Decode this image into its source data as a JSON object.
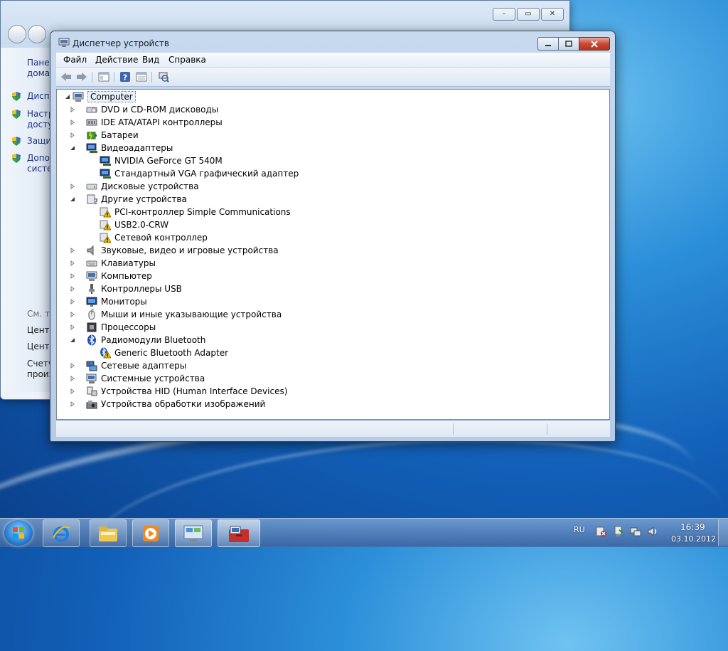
{
  "back_window": {
    "sidebar": [
      {
        "text": "Панел",
        "style": "link"
      },
      {
        "text": "домаш",
        "style": "link"
      },
      {
        "text": "Диспе",
        "style": "link",
        "shield": true
      },
      {
        "text": "Настр",
        "style": "link",
        "shield": true
      },
      {
        "text": "досту",
        "style": "link"
      },
      {
        "text": "Защит",
        "style": "link",
        "shield": true
      },
      {
        "text": "Допол",
        "style": "link",
        "shield": true
      },
      {
        "text": "систем",
        "style": "link"
      },
      {
        "text": "См. та",
        "style": "muted"
      },
      {
        "text": "Центр",
        "style": "dark"
      },
      {
        "text": "Центр",
        "style": "dark"
      },
      {
        "text": "Счетч",
        "style": "dark"
      },
      {
        "text": "произ",
        "style": "dark"
      }
    ]
  },
  "window": {
    "title": "Диспетчер устройств",
    "buttons": {
      "minimize": "minimize",
      "maximize": "maximize",
      "close": "close"
    }
  },
  "menu": [
    "Файл",
    "Действие",
    "Вид",
    "Справка"
  ],
  "toolbar": [
    "back-icon",
    "forward-icon",
    "console-tree-icon",
    "help-icon",
    "properties-icon",
    "scan-hardware-icon"
  ],
  "tree": {
    "root": "Computer",
    "items": [
      {
        "label": "DVD и CD-ROM дисководы",
        "icon": "dvd-drive-icon",
        "level": 1,
        "state": "collapsed"
      },
      {
        "label": "IDE ATA/ATAPI контроллеры",
        "icon": "ide-controller-icon",
        "level": 1,
        "state": "collapsed"
      },
      {
        "label": "Батареи",
        "icon": "battery-icon",
        "level": 1,
        "state": "collapsed"
      },
      {
        "label": "Видеоадаптеры",
        "icon": "display-adapter-icon",
        "level": 1,
        "state": "expanded"
      },
      {
        "label": "NVIDIA GeForce GT 540M",
        "icon": "display-adapter-icon",
        "level": 2,
        "state": "leaf"
      },
      {
        "label": "Стандартный VGA графический адаптер",
        "icon": "display-adapter-icon",
        "level": 2,
        "state": "leaf"
      },
      {
        "label": "Дисковые устройства",
        "icon": "disk-drive-icon",
        "level": 1,
        "state": "collapsed"
      },
      {
        "label": "Другие устройства",
        "icon": "unknown-device-icon",
        "level": 1,
        "state": "expanded"
      },
      {
        "label": "PCI-контроллер Simple Communications",
        "icon": "warning-device-icon",
        "level": 2,
        "state": "leaf"
      },
      {
        "label": "USB2.0-CRW",
        "icon": "warning-device-icon",
        "level": 2,
        "state": "leaf"
      },
      {
        "label": "Сетевой контроллер",
        "icon": "warning-device-icon",
        "level": 2,
        "state": "leaf"
      },
      {
        "label": "Звуковые, видео и игровые устройства",
        "icon": "speaker-icon",
        "level": 1,
        "state": "collapsed"
      },
      {
        "label": "Клавиатуры",
        "icon": "keyboard-icon",
        "level": 1,
        "state": "collapsed"
      },
      {
        "label": "Компьютер",
        "icon": "computer-icon",
        "level": 1,
        "state": "collapsed"
      },
      {
        "label": "Контроллеры USB",
        "icon": "usb-icon",
        "level": 1,
        "state": "collapsed"
      },
      {
        "label": "Мониторы",
        "icon": "monitor-icon",
        "level": 1,
        "state": "collapsed"
      },
      {
        "label": "Мыши и иные указывающие устройства",
        "icon": "mouse-icon",
        "level": 1,
        "state": "collapsed"
      },
      {
        "label": "Процессоры",
        "icon": "processor-icon",
        "level": 1,
        "state": "collapsed"
      },
      {
        "label": "Радиомодули Bluetooth",
        "icon": "bluetooth-icon",
        "level": 1,
        "state": "expanded"
      },
      {
        "label": "Generic Bluetooth Adapter",
        "icon": "bluetooth-warning-icon",
        "level": 2,
        "state": "leaf"
      },
      {
        "label": "Сетевые адаптеры",
        "icon": "network-adapter-icon",
        "level": 1,
        "state": "collapsed"
      },
      {
        "label": "Системные устройства",
        "icon": "system-device-icon",
        "level": 1,
        "state": "collapsed"
      },
      {
        "label": "Устройства HID (Human Interface Devices)",
        "icon": "hid-icon",
        "level": 1,
        "state": "collapsed"
      },
      {
        "label": "Устройства обработки изображений",
        "icon": "imaging-device-icon",
        "level": 1,
        "state": "collapsed"
      }
    ]
  },
  "taskbar": {
    "apps": [
      "internet-explorer-icon",
      "explorer-icon",
      "media-player-icon",
      "control-panel-icon",
      "device-manager-icon"
    ],
    "language": "RU",
    "time": "16:39",
    "date": "03.10.2012",
    "tray": [
      "action-center-icon",
      "safely-remove-icon",
      "network-icon",
      "volume-icon"
    ]
  },
  "colors": {
    "accent": "#1e3287",
    "warning": "#f5c400",
    "close": "#c94a35"
  }
}
